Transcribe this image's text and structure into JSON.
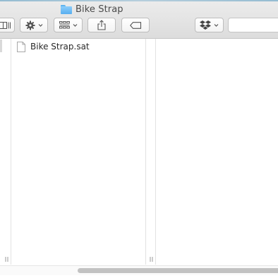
{
  "window": {
    "title": "Bike Strap",
    "title_icon": "folder-icon"
  },
  "toolbar": {
    "view_button_icon": "column-view-icon",
    "action_button_icon": "gear-icon",
    "arrange_button_icon": "grid-arrange-icon",
    "share_button_icon": "share-icon",
    "tag_button_icon": "tag-icon",
    "dropbox_button_icon": "dropbox-icon",
    "search_value": ""
  },
  "files": [
    {
      "name": "Bike Strap.sat",
      "icon": "document-icon"
    }
  ],
  "colors": {
    "toolbar_bg": "#e3e3e3",
    "folder_blue": "#58aef0",
    "scroll_thumb": "#c2c2c2"
  }
}
